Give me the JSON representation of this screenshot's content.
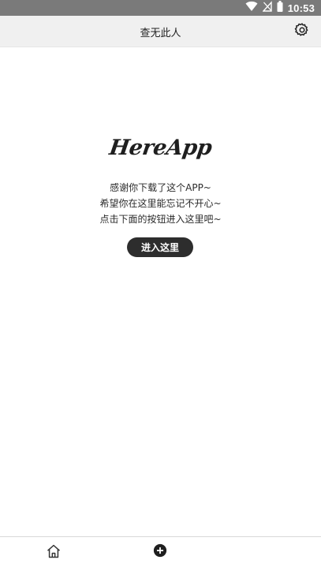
{
  "status_bar": {
    "time": "10:53",
    "icons": [
      "wifi-icon",
      "no-signal-icon",
      "battery-icon"
    ]
  },
  "header": {
    "title": "查无此人",
    "settings_icon": "gear-icon"
  },
  "main": {
    "logo_text": "HereApp",
    "lines": [
      "感谢你下载了这个APP~",
      "希望你在这里能忘记不开心~",
      "点击下面的按钮进入这里吧~"
    ],
    "enter_button_label": "进入这里"
  },
  "bottom_nav": {
    "items": [
      {
        "icon": "home-icon"
      },
      {
        "icon": "add-circle-icon"
      }
    ]
  },
  "colors": {
    "status_bar": "#7a7a7a",
    "top_bar": "#f0f0f0",
    "button": "#2d2d2d",
    "text": "#2b2b2b"
  }
}
